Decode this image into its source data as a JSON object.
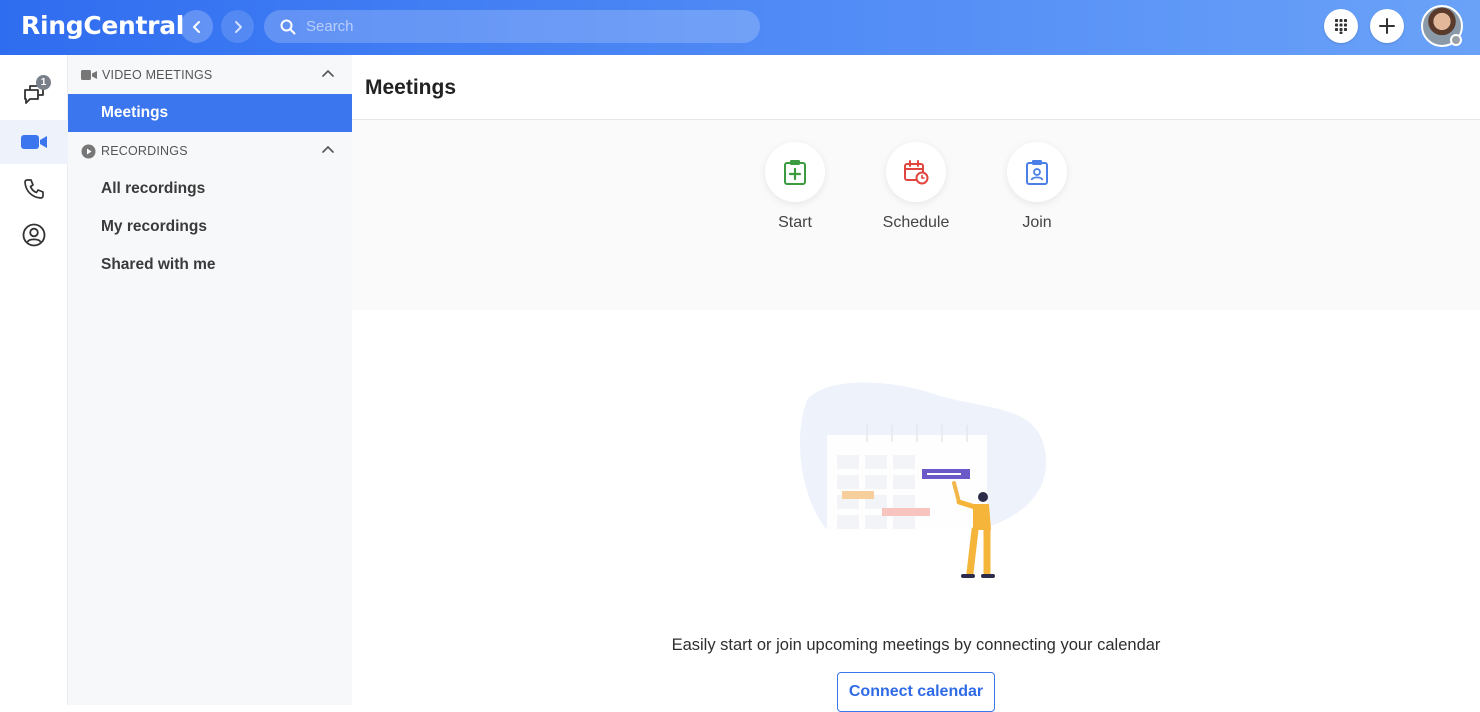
{
  "app": {
    "logo_text": "RingCentral",
    "search_placeholder": "Search",
    "accent_color": "#3b76ef",
    "header_gradient": [
      "#2f6df0",
      "#6aa2f8"
    ]
  },
  "rail": {
    "items": [
      {
        "icon": "messages-icon",
        "badge": "1"
      },
      {
        "icon": "video-icon",
        "active": true
      },
      {
        "icon": "phone-icon"
      },
      {
        "icon": "contacts-icon"
      }
    ]
  },
  "sidebar": {
    "video_section": {
      "label": "VIDEO MEETINGS",
      "icon": "video-icon"
    },
    "meetings_item": "Meetings",
    "recordings_section": {
      "label": "RECORDINGS",
      "icon": "play-circle-icon"
    },
    "recording_items": [
      "All recordings",
      "My recordings",
      "Shared with me"
    ]
  },
  "main": {
    "title": "Meetings",
    "actions": [
      {
        "label": "Start",
        "icon": "clipboard-plus-icon",
        "color": "#3d9b3f"
      },
      {
        "label": "Schedule",
        "icon": "calendar-clock-icon",
        "color": "#e0463d"
      },
      {
        "label": "Join",
        "icon": "clipboard-person-icon",
        "color": "#4a7fe6"
      }
    ],
    "empty_message": "Easily start or join upcoming meetings by connecting your calendar",
    "connect_button": "Connect calendar"
  }
}
